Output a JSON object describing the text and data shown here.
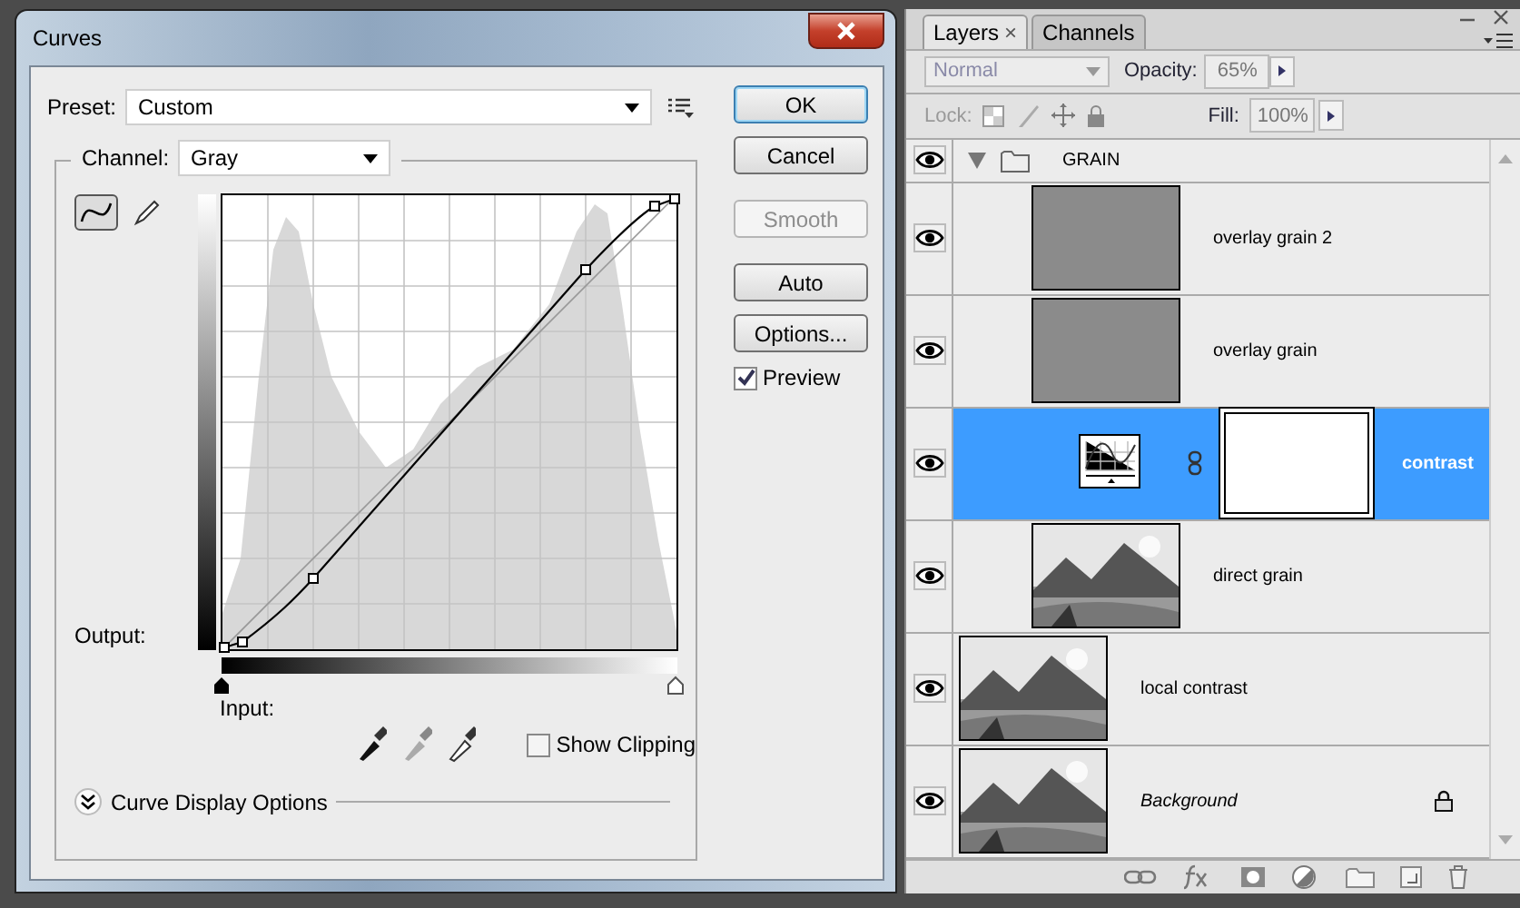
{
  "curves": {
    "title": "Curves",
    "preset": {
      "label": "Preset:",
      "value": "Custom"
    },
    "channel": {
      "label": "Channel:",
      "value": "Gray"
    },
    "tools": [
      {
        "kind": "curve",
        "selected": true
      },
      {
        "kind": "pencil",
        "selected": false
      }
    ],
    "input_sliders": [
      {
        "kind": "black_point",
        "level": 0
      },
      {
        "kind": "white_point",
        "level": 1
      }
    ],
    "output_label": "Output:",
    "input_label": "Input:",
    "buttons": [
      {
        "label": "OK",
        "default": true,
        "disabled": false
      },
      {
        "label": "Cancel",
        "default": false,
        "disabled": false
      },
      {
        "label": "Smooth",
        "default": false,
        "disabled": true
      },
      {
        "label": "Auto",
        "default": false,
        "disabled": false
      },
      {
        "label": "Options...",
        "default": false,
        "disabled": false
      }
    ],
    "preview": {
      "label": "Preview",
      "checked": true
    },
    "show_clipping": {
      "label": "Show Clipping",
      "checked": false
    },
    "display_options": {
      "label": "Curve Display Options",
      "expanded": false
    }
  },
  "layers_panel": {
    "tabs": [
      {
        "label": "Layers",
        "selected": true,
        "close": "×"
      },
      {
        "label": "Channels",
        "selected": false
      }
    ],
    "blend_mode": "Normal",
    "opacity": {
      "label": "Opacity:",
      "value": "65%"
    },
    "lock_label": "Lock:",
    "fill": {
      "label": "Fill:",
      "value": "100%"
    },
    "layers": [
      {
        "name": "GRAIN",
        "kind": "group",
        "visible": true,
        "expanded": true,
        "selected": false,
        "children": [
          {
            "name": "overlay grain 2",
            "kind": "pixel",
            "thumbnail": {
              "kind": "gray"
            },
            "visible": true,
            "selected": false
          },
          {
            "name": "overlay grain",
            "kind": "pixel",
            "thumbnail": {
              "kind": "gray"
            },
            "visible": true,
            "selected": false
          },
          {
            "name": "contrast",
            "kind": "adjustment",
            "visible": true,
            "selected": true
          },
          {
            "name": "direct grain",
            "kind": "pixel",
            "visible": true,
            "selected": false
          }
        ]
      },
      {
        "name": "local contrast",
        "kind": "pixel",
        "visible": true,
        "selected": false
      },
      {
        "name": "Background",
        "kind": "background",
        "visible": true,
        "selected": false,
        "locked": true
      }
    ]
  }
}
